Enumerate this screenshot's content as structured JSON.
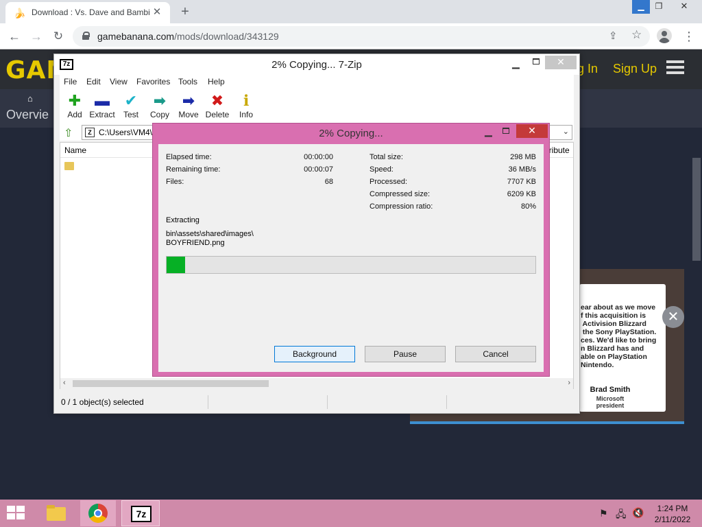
{
  "browser": {
    "tab_title": "Download : Vs. Dave and Bambi",
    "tab_close": "✕",
    "new_tab": "+",
    "window_controls": {
      "minimize": "▁",
      "maximize": "❐",
      "close": "✕"
    },
    "nav": {
      "back": "←",
      "forward": "→",
      "reload": "↻"
    },
    "url_domain": "gamebanana.com",
    "url_path": "/mods/download/343129",
    "menu": "⋮"
  },
  "webpage": {
    "logo_text": "GAM",
    "login_label": "og In",
    "signup_label": "Sign Up",
    "nav_tab": "Overvie",
    "quote_lines": "ear about as we move\nf this acquisition is\n Activision Blizzard\n the Sony PlayStation.\nces. We'd like to bring\nn Blizzard has and\nable on PlayStation\nNintendo.",
    "quote_author": "Brad Smith",
    "quote_role": "Microsoft president",
    "close_glyph": "✕"
  },
  "zip_window": {
    "title": "2% Copying... 7-Zip",
    "app_icon": "7z",
    "menu": [
      "File",
      "Edit",
      "View",
      "Favorites",
      "Tools",
      "Help"
    ],
    "toolbar": [
      {
        "label": "Add",
        "icon": "plus-icon",
        "glyph": "✚",
        "color": "#1fa31f"
      },
      {
        "label": "Extract",
        "icon": "minus-icon",
        "glyph": "▬",
        "color": "#1b2ba8"
      },
      {
        "label": "Test",
        "icon": "check-icon",
        "glyph": "✔",
        "color": "#1db3c9"
      },
      {
        "label": "Copy",
        "icon": "copy-arrow-icon",
        "glyph": "➡",
        "color": "#1a9a8a"
      },
      {
        "label": "Move",
        "icon": "move-arrow-icon",
        "glyph": "➡",
        "color": "#1b2ba8"
      },
      {
        "label": "Delete",
        "icon": "delete-x-icon",
        "glyph": "✖",
        "color": "#d11a1a"
      },
      {
        "label": "Info",
        "icon": "info-icon",
        "glyph": "ℹ",
        "color": "#c8a800"
      }
    ],
    "address": "C:\\Users\\VM4\\",
    "address_icon": "Z",
    "columns": {
      "name": "Name",
      "attributes": "ttribute"
    },
    "status": "0 / 1 object(s) selected"
  },
  "progress_dialog": {
    "title": "2% Copying...",
    "elapsed_label": "Elapsed time:",
    "elapsed_value": "00:00:00",
    "remaining_label": "Remaining time:",
    "remaining_value": "00:00:07",
    "files_label": "Files:",
    "files_value": "68",
    "total_size_label": "Total size:",
    "total_size_value": "298 MB",
    "speed_label": "Speed:",
    "speed_value": "36 MB/s",
    "processed_label": "Processed:",
    "processed_value": "7707 KB",
    "compressed_label": "Compressed size:",
    "compressed_value": "6209 KB",
    "ratio_label": "Compression ratio:",
    "ratio_value": "80%",
    "action": "Extracting",
    "current_file_line1": "bin\\assets\\shared\\images\\",
    "current_file_line2": "BOYFRIEND.png",
    "progress_percent": 5,
    "buttons": {
      "background": "Background",
      "pause": "Pause",
      "cancel": "Cancel"
    }
  },
  "taskbar": {
    "time": "1:24 PM",
    "date": "2/11/2022",
    "zip_label": "7z"
  }
}
